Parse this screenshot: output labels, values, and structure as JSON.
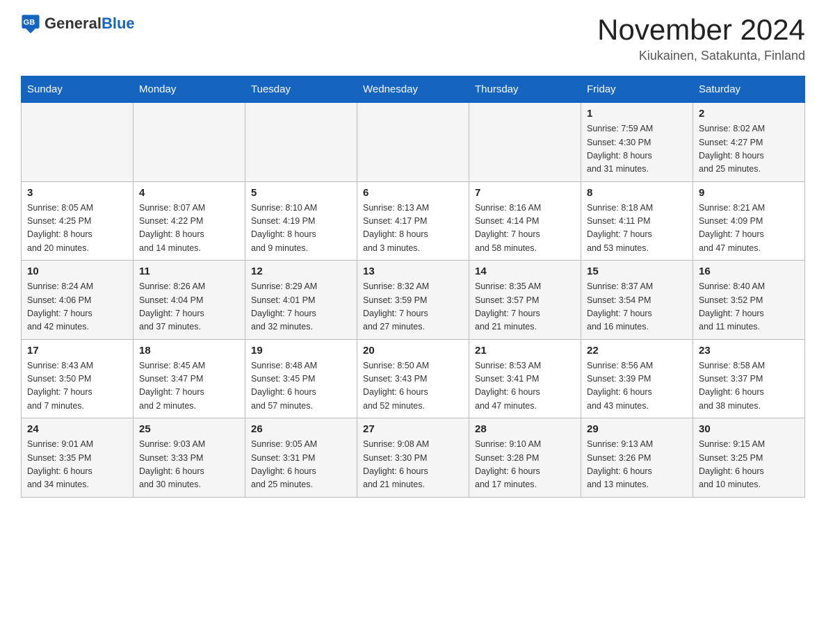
{
  "header": {
    "logo_general": "General",
    "logo_blue": "Blue",
    "month_title": "November 2024",
    "location": "Kiukainen, Satakunta, Finland"
  },
  "weekdays": [
    "Sunday",
    "Monday",
    "Tuesday",
    "Wednesday",
    "Thursday",
    "Friday",
    "Saturday"
  ],
  "weeks": [
    [
      {
        "day": "",
        "info": ""
      },
      {
        "day": "",
        "info": ""
      },
      {
        "day": "",
        "info": ""
      },
      {
        "day": "",
        "info": ""
      },
      {
        "day": "",
        "info": ""
      },
      {
        "day": "1",
        "info": "Sunrise: 7:59 AM\nSunset: 4:30 PM\nDaylight: 8 hours\nand 31 minutes."
      },
      {
        "day": "2",
        "info": "Sunrise: 8:02 AM\nSunset: 4:27 PM\nDaylight: 8 hours\nand 25 minutes."
      }
    ],
    [
      {
        "day": "3",
        "info": "Sunrise: 8:05 AM\nSunset: 4:25 PM\nDaylight: 8 hours\nand 20 minutes."
      },
      {
        "day": "4",
        "info": "Sunrise: 8:07 AM\nSunset: 4:22 PM\nDaylight: 8 hours\nand 14 minutes."
      },
      {
        "day": "5",
        "info": "Sunrise: 8:10 AM\nSunset: 4:19 PM\nDaylight: 8 hours\nand 9 minutes."
      },
      {
        "day": "6",
        "info": "Sunrise: 8:13 AM\nSunset: 4:17 PM\nDaylight: 8 hours\nand 3 minutes."
      },
      {
        "day": "7",
        "info": "Sunrise: 8:16 AM\nSunset: 4:14 PM\nDaylight: 7 hours\nand 58 minutes."
      },
      {
        "day": "8",
        "info": "Sunrise: 8:18 AM\nSunset: 4:11 PM\nDaylight: 7 hours\nand 53 minutes."
      },
      {
        "day": "9",
        "info": "Sunrise: 8:21 AM\nSunset: 4:09 PM\nDaylight: 7 hours\nand 47 minutes."
      }
    ],
    [
      {
        "day": "10",
        "info": "Sunrise: 8:24 AM\nSunset: 4:06 PM\nDaylight: 7 hours\nand 42 minutes."
      },
      {
        "day": "11",
        "info": "Sunrise: 8:26 AM\nSunset: 4:04 PM\nDaylight: 7 hours\nand 37 minutes."
      },
      {
        "day": "12",
        "info": "Sunrise: 8:29 AM\nSunset: 4:01 PM\nDaylight: 7 hours\nand 32 minutes."
      },
      {
        "day": "13",
        "info": "Sunrise: 8:32 AM\nSunset: 3:59 PM\nDaylight: 7 hours\nand 27 minutes."
      },
      {
        "day": "14",
        "info": "Sunrise: 8:35 AM\nSunset: 3:57 PM\nDaylight: 7 hours\nand 21 minutes."
      },
      {
        "day": "15",
        "info": "Sunrise: 8:37 AM\nSunset: 3:54 PM\nDaylight: 7 hours\nand 16 minutes."
      },
      {
        "day": "16",
        "info": "Sunrise: 8:40 AM\nSunset: 3:52 PM\nDaylight: 7 hours\nand 11 minutes."
      }
    ],
    [
      {
        "day": "17",
        "info": "Sunrise: 8:43 AM\nSunset: 3:50 PM\nDaylight: 7 hours\nand 7 minutes."
      },
      {
        "day": "18",
        "info": "Sunrise: 8:45 AM\nSunset: 3:47 PM\nDaylight: 7 hours\nand 2 minutes."
      },
      {
        "day": "19",
        "info": "Sunrise: 8:48 AM\nSunset: 3:45 PM\nDaylight: 6 hours\nand 57 minutes."
      },
      {
        "day": "20",
        "info": "Sunrise: 8:50 AM\nSunset: 3:43 PM\nDaylight: 6 hours\nand 52 minutes."
      },
      {
        "day": "21",
        "info": "Sunrise: 8:53 AM\nSunset: 3:41 PM\nDaylight: 6 hours\nand 47 minutes."
      },
      {
        "day": "22",
        "info": "Sunrise: 8:56 AM\nSunset: 3:39 PM\nDaylight: 6 hours\nand 43 minutes."
      },
      {
        "day": "23",
        "info": "Sunrise: 8:58 AM\nSunset: 3:37 PM\nDaylight: 6 hours\nand 38 minutes."
      }
    ],
    [
      {
        "day": "24",
        "info": "Sunrise: 9:01 AM\nSunset: 3:35 PM\nDaylight: 6 hours\nand 34 minutes."
      },
      {
        "day": "25",
        "info": "Sunrise: 9:03 AM\nSunset: 3:33 PM\nDaylight: 6 hours\nand 30 minutes."
      },
      {
        "day": "26",
        "info": "Sunrise: 9:05 AM\nSunset: 3:31 PM\nDaylight: 6 hours\nand 25 minutes."
      },
      {
        "day": "27",
        "info": "Sunrise: 9:08 AM\nSunset: 3:30 PM\nDaylight: 6 hours\nand 21 minutes."
      },
      {
        "day": "28",
        "info": "Sunrise: 9:10 AM\nSunset: 3:28 PM\nDaylight: 6 hours\nand 17 minutes."
      },
      {
        "day": "29",
        "info": "Sunrise: 9:13 AM\nSunset: 3:26 PM\nDaylight: 6 hours\nand 13 minutes."
      },
      {
        "day": "30",
        "info": "Sunrise: 9:15 AM\nSunset: 3:25 PM\nDaylight: 6 hours\nand 10 minutes."
      }
    ]
  ]
}
